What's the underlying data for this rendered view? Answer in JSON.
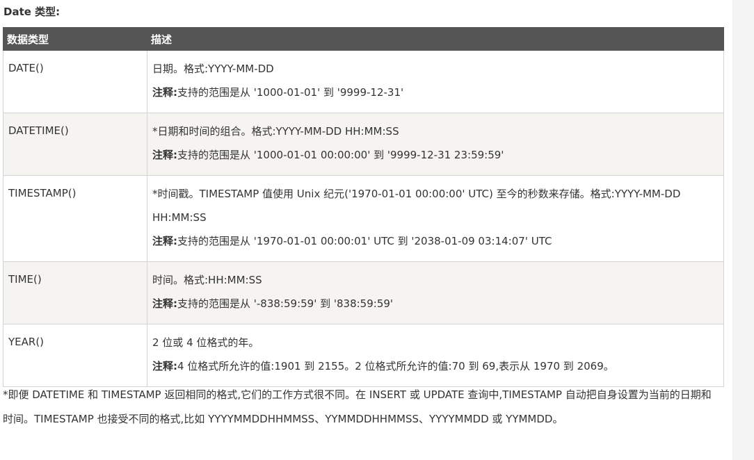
{
  "section_title": "Date 类型:",
  "table": {
    "headers": [
      "数据类型",
      "描述"
    ],
    "note_label": "注释:",
    "rows": [
      {
        "type": "DATE()",
        "description": "日期。格式:YYYY-MM-DD",
        "note": "支持的范围是从 '1000-01-01' 到 '9999-12-31'"
      },
      {
        "type": "DATETIME()",
        "description": "*日期和时间的组合。格式:YYYY-MM-DD HH:MM:SS",
        "note": "支持的范围是从 '1000-01-01 00:00:00' 到 '9999-12-31 23:59:59'"
      },
      {
        "type": "TIMESTAMP()",
        "description": "*时间戳。TIMESTAMP 值使用 Unix 纪元('1970-01-01 00:00:00' UTC) 至今的秒数来存储。格式:YYYY-MM-DD HH:MM:SS",
        "note": "支持的范围是从 '1970-01-01 00:00:01' UTC 到 '2038-01-09 03:14:07' UTC"
      },
      {
        "type": "TIME()",
        "description": "时间。格式:HH:MM:SS",
        "note": "支持的范围是从 '-838:59:59' 到 '838:59:59'"
      },
      {
        "type": "YEAR()",
        "description": "2 位或 4 位格式的年。",
        "note": "4 位格式所允许的值:1901 到 2155。2 位格式所允许的值:70 到 69,表示从 1970 到 2069。"
      }
    ]
  },
  "footnote": "*即便 DATETIME 和 TIMESTAMP 返回相同的格式,它们的工作方式很不同。在 INSERT 或 UPDATE 查询中,TIMESTAMP 自动把自身设置为当前的日期和时间。TIMESTAMP 也接受不同的格式,比如 YYYYMMDDHHMMSS、YYMMDDHHMMSS、YYYYMMDD 或 YYMMDD。"
}
